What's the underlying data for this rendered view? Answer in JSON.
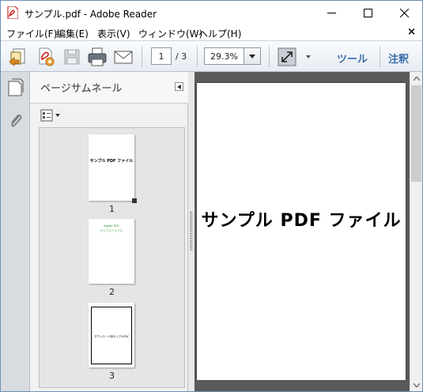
{
  "window": {
    "title": "サンプル.pdf - Adobe Reader",
    "icon": "adobe-reader-icon"
  },
  "menu": {
    "items": [
      "ファイル(F)",
      "編集(E)",
      "表示(V)",
      "ウィンドウ(W)",
      "ヘルプ(H)"
    ],
    "close_glyph": "×"
  },
  "toolbar": {
    "icons": [
      "create-pdf-icon",
      "share-icon",
      "save-icon",
      "print-icon",
      "email-icon"
    ],
    "page_current": "1",
    "page_total": "/ 3",
    "zoom": "29.3%",
    "tools_label": "ツール",
    "comment_label": "注釈"
  },
  "sidebar": {
    "panel_title": "ページサムネール",
    "icons": [
      "page-thumbnails-icon",
      "attachments-icon"
    ]
  },
  "thumbnails": [
    {
      "page_label": "1",
      "text": "サンプル PDF ファイル"
    },
    {
      "page_label": "2",
      "text_lines": [
        "Adobe PDF",
        "サンプルファイル"
      ]
    },
    {
      "page_label": "3",
      "text": "ダウンロード用サンプルPDF"
    }
  ],
  "document": {
    "heading": "サンプル PDF ファイル"
  },
  "colors": {
    "accent_link": "#3c6ea8",
    "doc_background": "#5a5a5a",
    "thumb2_text": "#2e9a2e"
  }
}
